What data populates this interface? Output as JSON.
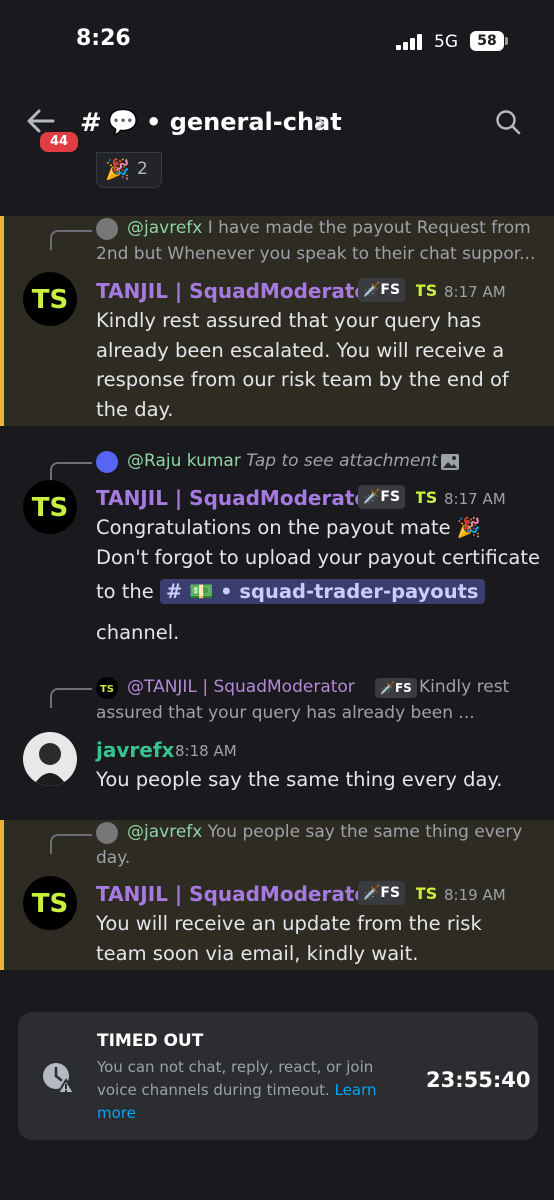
{
  "status_bar": {
    "time": "8:26",
    "network": "5G",
    "battery": "58"
  },
  "header": {
    "unread_badge": "44",
    "hash": "#",
    "channel_emoji": "💬",
    "channel_name": "• general-chat"
  },
  "reaction": {
    "emoji": "🎉",
    "count": "2"
  },
  "colors": {
    "highlight_bg": "#2d2b22",
    "highlight_border": "#f0b232",
    "moderator_name": "#a67ae0",
    "user_name": "#35c48f",
    "link": "#00a8fc"
  },
  "messages": [
    {
      "reply": {
        "mention": "@javrefx",
        "text": " I have made the payout Request from",
        "text2": "2nd but Whenever you speak to their chat suppor..."
      },
      "author": "TANJIL | SquadModerator",
      "tag": "🗡️FS",
      "time": "8:17 AM",
      "body": "Kindly rest assured that your query has already been escalated. You will receive a response from our risk team by the end of the day."
    },
    {
      "reply": {
        "mention": "@Raju kumar",
        "text": " Tap to see attachment"
      },
      "author": "TANJIL | SquadModerator",
      "tag": "🗡️FS",
      "time": "8:17 AM",
      "body_line1": "Congratulations on the payout mate 🎉",
      "body_line2": "Don't forgot to upload your payout certificate",
      "body_line3_pre": "to the",
      "channel_link": "# 💵 • squad-trader-payouts",
      "body_line4": "channel."
    },
    {
      "reply": {
        "mention": "@TANJIL | SquadModerator",
        "tag": "🗡️FS",
        "text": " Kindly rest",
        "text2": "assured that your query has already been ..."
      },
      "author": "javrefx",
      "time": "8:18 AM",
      "body": "You people say the same thing every day."
    },
    {
      "reply": {
        "mention": "@javrefx",
        "text": " You people say the same thing every",
        "text2": "day."
      },
      "author": "TANJIL | SquadModerator",
      "tag": "🗡️FS",
      "time": "8:19 AM",
      "body": "You will receive an update from the risk team soon via email, kindly wait."
    }
  ],
  "timeout": {
    "title": "TIMED OUT",
    "description": "You can not chat, reply, react, or join voice channels during timeout. ",
    "learn_more": "Learn more",
    "timer": "23:55:40"
  }
}
